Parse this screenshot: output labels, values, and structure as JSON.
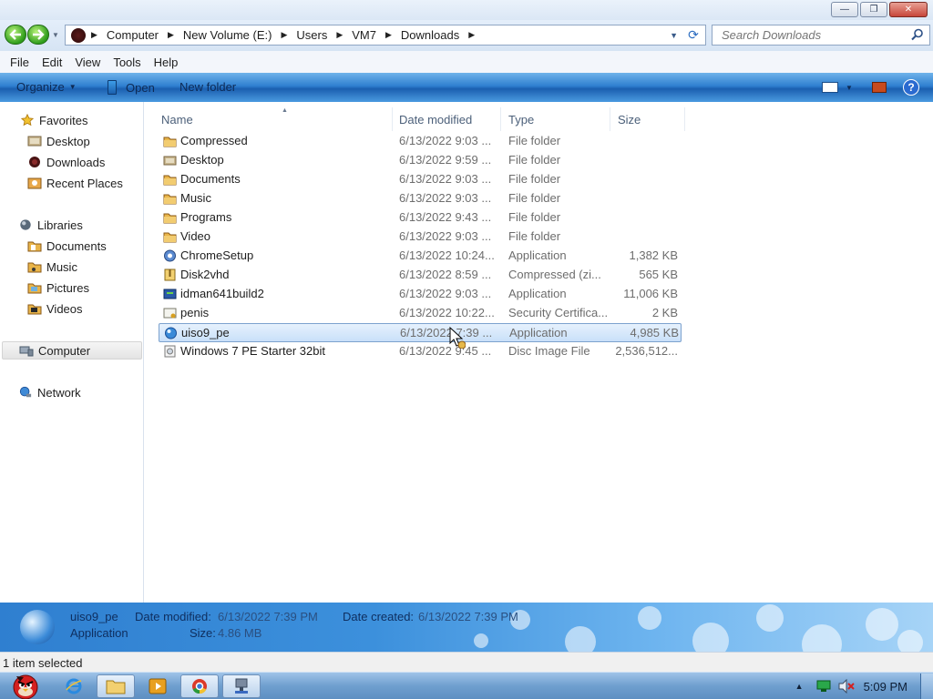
{
  "window": {
    "minimize_glyph": "—",
    "restore_glyph": "❐",
    "close_glyph": "✕"
  },
  "address_bar": {
    "breadcrumbs": [
      "Computer",
      "New Volume (E:)",
      "Users",
      "VM7",
      "Downloads"
    ],
    "search_placeholder": "Search Downloads"
  },
  "menu": [
    "File",
    "Edit",
    "View",
    "Tools",
    "Help"
  ],
  "command_bar": {
    "organize": "Organize",
    "open": "Open",
    "new_folder": "New folder"
  },
  "navigation": {
    "favorites": {
      "label": "Favorites",
      "items": [
        "Desktop",
        "Downloads",
        "Recent Places"
      ]
    },
    "libraries": {
      "label": "Libraries",
      "items": [
        "Documents",
        "Music",
        "Pictures",
        "Videos"
      ]
    },
    "computer": "Computer",
    "network": "Network"
  },
  "columns": [
    "Name",
    "Date modified",
    "Type",
    "Size"
  ],
  "files": [
    {
      "name": "Compressed",
      "date": "6/13/2022 9:03 ...",
      "type": "File folder",
      "size": "",
      "icon": "folder-icon"
    },
    {
      "name": "Desktop",
      "date": "6/13/2022 9:59 ...",
      "type": "File folder",
      "size": "",
      "icon": "desktop-folder-icon"
    },
    {
      "name": "Documents",
      "date": "6/13/2022 9:03 ...",
      "type": "File folder",
      "size": "",
      "icon": "folder-icon"
    },
    {
      "name": "Music",
      "date": "6/13/2022 9:03 ...",
      "type": "File folder",
      "size": "",
      "icon": "folder-icon"
    },
    {
      "name": "Programs",
      "date": "6/13/2022 9:43 ...",
      "type": "File folder",
      "size": "",
      "icon": "folder-icon"
    },
    {
      "name": "Video",
      "date": "6/13/2022 9:03 ...",
      "type": "File folder",
      "size": "",
      "icon": "folder-icon"
    },
    {
      "name": "ChromeSetup",
      "date": "6/13/2022 10:24...",
      "type": "Application",
      "size": "1,382 KB",
      "icon": "chrome-setup-icon"
    },
    {
      "name": "Disk2vhd",
      "date": "6/13/2022 8:59 ...",
      "type": "Compressed (zi...",
      "size": "565 KB",
      "icon": "zip-icon"
    },
    {
      "name": "idman641build2",
      "date": "6/13/2022 9:03 ...",
      "type": "Application",
      "size": "11,006 KB",
      "icon": "idm-icon"
    },
    {
      "name": "penis",
      "date": "6/13/2022 10:22...",
      "type": "Security Certifica...",
      "size": "2 KB",
      "icon": "certificate-icon"
    },
    {
      "name": "uiso9_pe",
      "date": "6/13/2022 7:39 ...",
      "type": "Application",
      "size": "4,985 KB",
      "icon": "ultraiso-icon"
    },
    {
      "name": "Windows 7 PE Starter 32bit",
      "date": "6/13/2022 9:45 ...",
      "type": "Disc Image File",
      "size": "2,536,512...",
      "icon": "disc-image-icon"
    }
  ],
  "selected_index": 10,
  "details": {
    "name": "uiso9_pe",
    "kind": "Application",
    "modified_label": "Date modified:",
    "modified_value": "6/13/2022 7:39 PM",
    "created_label": "Date created:",
    "created_value": "6/13/2022 7:39 PM",
    "size_label": "Size:",
    "size_value": "4.86 MB"
  },
  "status": "1 item selected",
  "taskbar": {
    "clock": "5:09 PM"
  }
}
